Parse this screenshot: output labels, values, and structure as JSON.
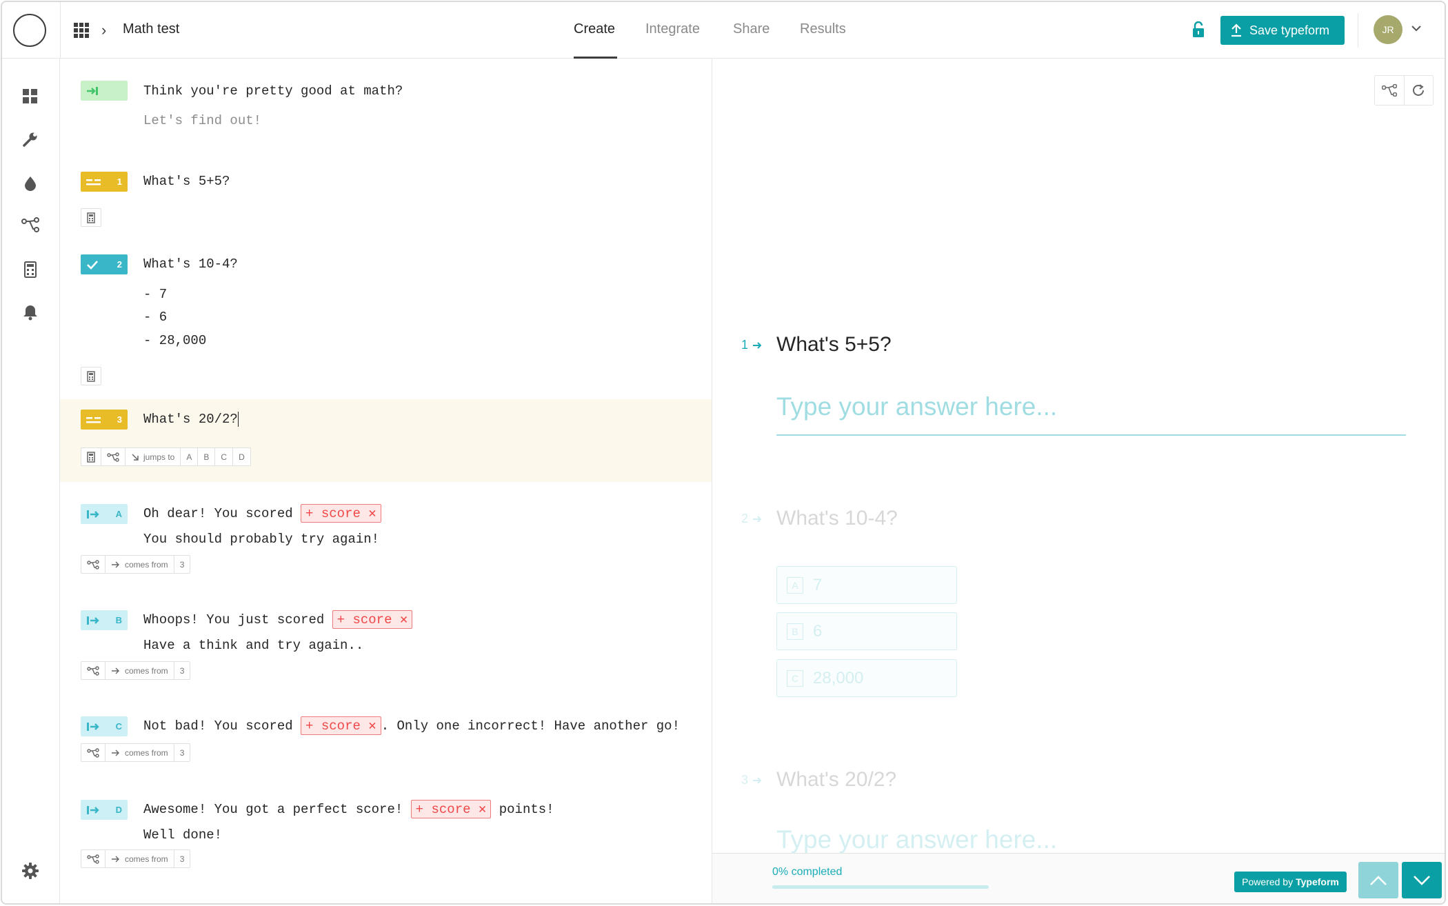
{
  "app": {
    "form_title": "Math test"
  },
  "tabs": [
    {
      "label": "Create",
      "active": true
    },
    {
      "label": "Integrate",
      "active": false
    },
    {
      "label": "Share",
      "active": false
    },
    {
      "label": "Results",
      "active": false
    }
  ],
  "header": {
    "save_label": "Save typeform",
    "avatar_initials": "JR",
    "accent": "#0a9fa5"
  },
  "sidebar": {
    "icons": [
      "dashboard-icon",
      "wrench-icon",
      "drop-icon",
      "logic-icon",
      "calculator-icon",
      "bell-icon",
      "gear-icon"
    ]
  },
  "builder": {
    "welcome": {
      "title": "Think you're pretty good at math?",
      "subtitle": "Let's find out!"
    },
    "q1": {
      "num": "1",
      "title": "What's 5+5?"
    },
    "q2": {
      "num": "2",
      "title": "What's 10-4?",
      "choices": [
        "- 7",
        "- 6",
        "- 28,000"
      ]
    },
    "q3": {
      "num": "3",
      "title": "What's 20/2?",
      "jumps_label": "jumps to",
      "targets": [
        "A",
        "B",
        "C",
        "D"
      ]
    },
    "score_label": "score",
    "comes_from_label": "comes from",
    "comes_from_num": "3",
    "endings": [
      {
        "key": "A",
        "before": "Oh dear! You scored",
        "after": "",
        "line2": "You should probably try again!"
      },
      {
        "key": "B",
        "before": "Whoops! You just scored",
        "after": "",
        "line2": "Have a think and try again.."
      },
      {
        "key": "C",
        "before": "Not bad! You scored",
        "after": ". Only one incorrect! Have another go!",
        "line2": ""
      },
      {
        "key": "D",
        "before": "Awesome! You got a perfect score!",
        "after": "points!",
        "line2": "Well done!"
      }
    ]
  },
  "preview": {
    "q1": {
      "num": "1",
      "title": "What's 5+5?",
      "placeholder": "Type your answer here..."
    },
    "q2": {
      "num": "2",
      "title": "What's 10-4?",
      "choices": [
        {
          "key": "A",
          "label": "7"
        },
        {
          "key": "B",
          "label": "6"
        },
        {
          "key": "C",
          "label": "28,000"
        }
      ]
    },
    "q3": {
      "num": "3",
      "title": "What's 20/2?",
      "placeholder": "Type your answer here..."
    },
    "progress_label": "0% completed",
    "progress_value": 0,
    "powered_by": "Powered by",
    "powered_brand": "Typeform"
  }
}
